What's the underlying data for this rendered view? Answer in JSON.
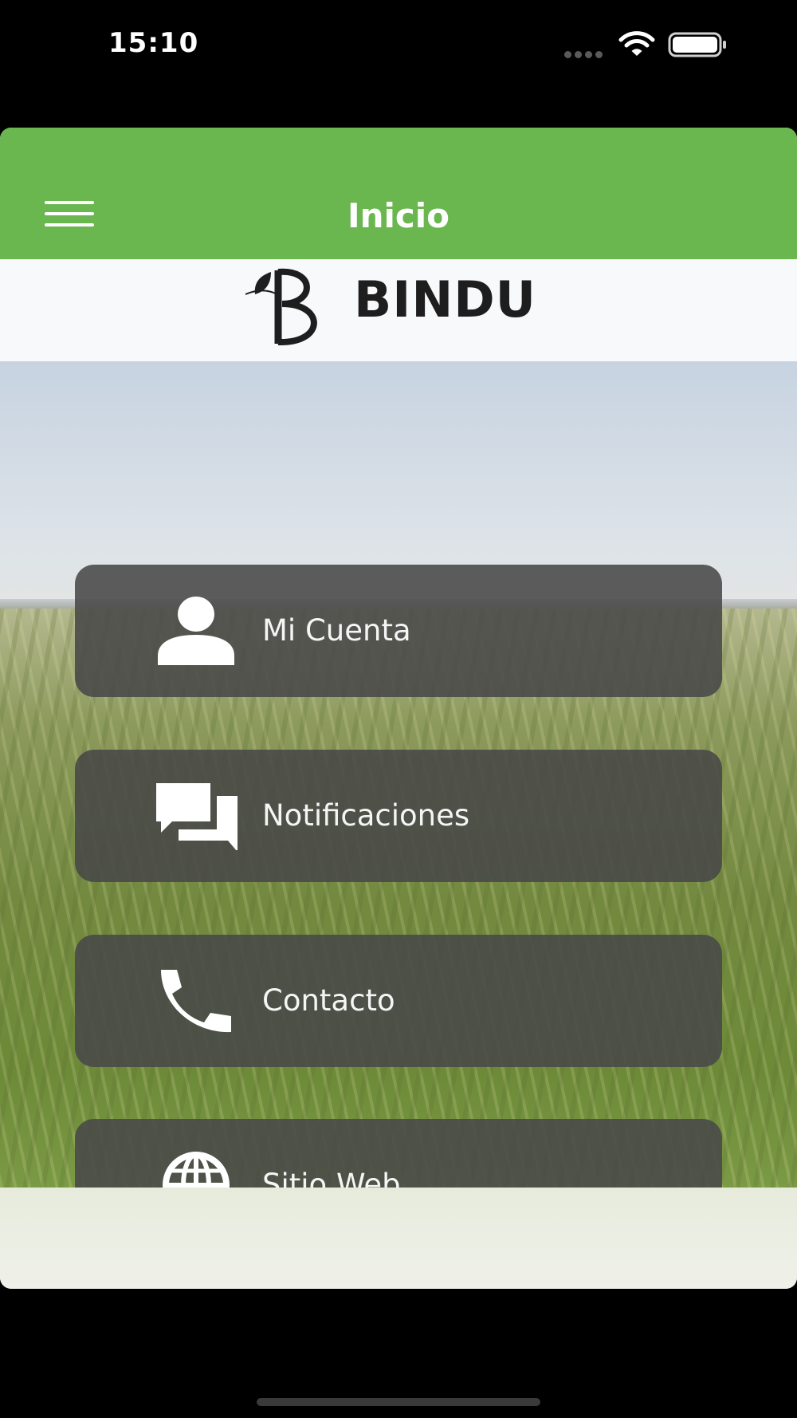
{
  "status_bar": {
    "time": "15:10"
  },
  "header": {
    "title": "Inicio"
  },
  "logo": {
    "text": "BINDU"
  },
  "menu_items": [
    {
      "label": "Mi Cuenta",
      "icon": "person-icon"
    },
    {
      "label": "Notificaciones",
      "icon": "chat-bubbles-icon"
    },
    {
      "label": "Contacto",
      "icon": "phone-icon"
    },
    {
      "label": "Sitio Web",
      "icon": "globe-icon"
    }
  ],
  "colors": {
    "header_green": "#6ab750",
    "button_gray": "#484848"
  }
}
